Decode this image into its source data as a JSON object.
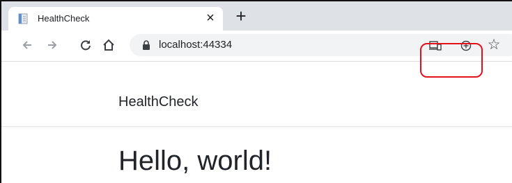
{
  "tab": {
    "title": "HealthCheck",
    "close_glyph": "×",
    "favicon": "document-icon"
  },
  "new_tab_glyph": "+",
  "toolbar": {
    "back_icon": "back-arrow-icon",
    "forward_icon": "forward-arrow-icon",
    "reload_icon": "reload-icon",
    "home_icon": "home-icon",
    "url": "localhost:44334",
    "lock_icon": "lock-icon",
    "install_app_icon": "install-app-icon",
    "add_icon": "add-circle-icon",
    "bookmark_glyph": "☆"
  },
  "highlight_color": "#e3101c",
  "page": {
    "brand": "HealthCheck",
    "heading": "Hello, world!"
  }
}
